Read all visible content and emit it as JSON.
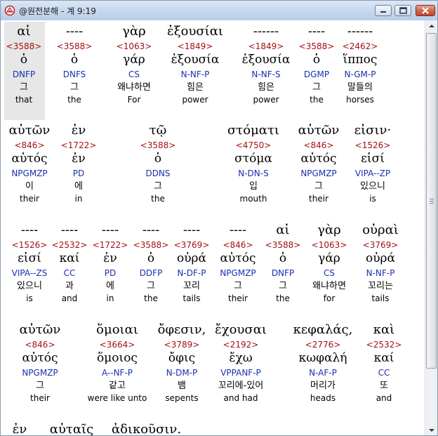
{
  "window": {
    "title": "@원전분해 - 계 9:19"
  },
  "rows": [
    [
      {
        "greek": "αἱ",
        "strong": "<3588>",
        "lemma": "ὁ",
        "parse": "DNFP",
        "korean": "그",
        "english": "that"
      },
      {
        "greek": "----",
        "strong": "<3588>",
        "lemma": "ὁ",
        "parse": "DNFS",
        "korean": "그",
        "english": "the"
      },
      {
        "greek": "γὰρ",
        "strong": "<1063>",
        "lemma": "γάρ",
        "parse": "CS",
        "korean": "왜냐하면",
        "english": "For"
      },
      {
        "greek": "ἐξουσίαι",
        "strong": "<1849>",
        "lemma": "ἐξουσία",
        "parse": "N-NF-P",
        "korean": "힘은",
        "english": "power"
      },
      {
        "greek": "------",
        "strong": "<1849>",
        "lemma": "ἐξουσία",
        "parse": "N-NF-S",
        "korean": "힘은",
        "english": "power"
      },
      {
        "greek": "----",
        "strong": "<3588>",
        "lemma": "ὁ",
        "parse": "DGMP",
        "korean": "그",
        "english": "the"
      },
      {
        "greek": "------",
        "strong": "<2462>",
        "lemma": "ἵππος",
        "parse": "N-GM-P",
        "korean": "말들의",
        "english": "horses"
      }
    ],
    [
      {
        "greek": "αὐτῶν",
        "strong": "<846>",
        "lemma": "αὐτός",
        "parse": "NPGMZP",
        "korean": "이",
        "english": "their"
      },
      {
        "greek": "ἐν",
        "strong": "<1722>",
        "lemma": "ἐν",
        "parse": "PD",
        "korean": "에",
        "english": "in"
      },
      {
        "greek": "τῷ",
        "strong": "<3588>",
        "lemma": "ὁ",
        "parse": "DDNS",
        "korean": "그",
        "english": "the"
      },
      {
        "greek": "στόματι",
        "strong": "<4750>",
        "lemma": "στόμα",
        "parse": "N-DN-S",
        "korean": "입",
        "english": "mouth"
      },
      {
        "greek": "αὐτῶν",
        "strong": "<846>",
        "lemma": "αὐτός",
        "parse": "NPGMZP",
        "korean": "그",
        "english": "their"
      },
      {
        "greek": "εἰσιν·",
        "strong": "<1526>",
        "lemma": "εἰσί",
        "parse": "VIPA--ZP",
        "korean": "있으니",
        "english": "is"
      }
    ],
    [
      {
        "greek": "----",
        "strong": "<1526>",
        "lemma": "εἰσί",
        "parse": "VIPA--ZS",
        "korean": "있으니",
        "english": "is"
      },
      {
        "greek": "----",
        "strong": "<2532>",
        "lemma": "καί",
        "parse": "CC",
        "korean": "과",
        "english": "and"
      },
      {
        "greek": "----",
        "strong": "<1722>",
        "lemma": "ἐν",
        "parse": "PD",
        "korean": "에",
        "english": "in"
      },
      {
        "greek": "----",
        "strong": "<3588>",
        "lemma": "ὁ",
        "parse": "DDFP",
        "korean": "그",
        "english": "the"
      },
      {
        "greek": "----",
        "strong": "<3769>",
        "lemma": "οὐρά",
        "parse": "N-DF-P",
        "korean": "꼬리",
        "english": "tails"
      },
      {
        "greek": "----",
        "strong": "<846>",
        "lemma": "αὐτός",
        "parse": "NPGMZP",
        "korean": "그",
        "english": "their"
      },
      {
        "greek": "αἱ",
        "strong": "<3588>",
        "lemma": "ὁ",
        "parse": "DNFP",
        "korean": "그",
        "english": "the"
      },
      {
        "greek": "γὰρ",
        "strong": "<1063>",
        "lemma": "γάρ",
        "parse": "CS",
        "korean": "왜냐하면",
        "english": "for"
      },
      {
        "greek": "οὐραὶ",
        "strong": "<3769>",
        "lemma": "οὐρά",
        "parse": "N-NF-P",
        "korean": "꼬리는",
        "english": "tails"
      }
    ],
    [
      {
        "greek": "αὐτῶν",
        "strong": "<846>",
        "lemma": "αὐτός",
        "parse": "NPGMZP",
        "korean": "그",
        "english": "their"
      },
      {
        "greek": "ὅμοιαι",
        "strong": "<3664>",
        "lemma": "ὅμοιος",
        "parse": "A--NF-P",
        "korean": "같고",
        "english": "were like unto"
      },
      {
        "greek": "ὄφεσιν,",
        "strong": "<3789>",
        "lemma": "ὄφις",
        "parse": "N-DM-P",
        "korean": "뱀",
        "english": "sepents"
      },
      {
        "greek": "ἔχουσαι",
        "strong": "<2192>",
        "lemma": "ἔχω",
        "parse": "VPPANF-P",
        "korean": "꼬리에-있어",
        "english": "and had"
      },
      {
        "greek": "κεφαλάς,",
        "strong": "<2776>",
        "lemma": "κωφαλή",
        "parse": "N-AF-P",
        "korean": "머리가",
        "english": "heads"
      },
      {
        "greek": "καὶ",
        "strong": "<2532>",
        "lemma": "καί",
        "parse": "CC",
        "korean": "또",
        "english": "and"
      }
    ]
  ],
  "partial_row": [
    {
      "greek": "ἐν"
    },
    {
      "greek": "αὐταῖς"
    },
    {
      "greek": "ἀδικοῦσιν."
    }
  ]
}
